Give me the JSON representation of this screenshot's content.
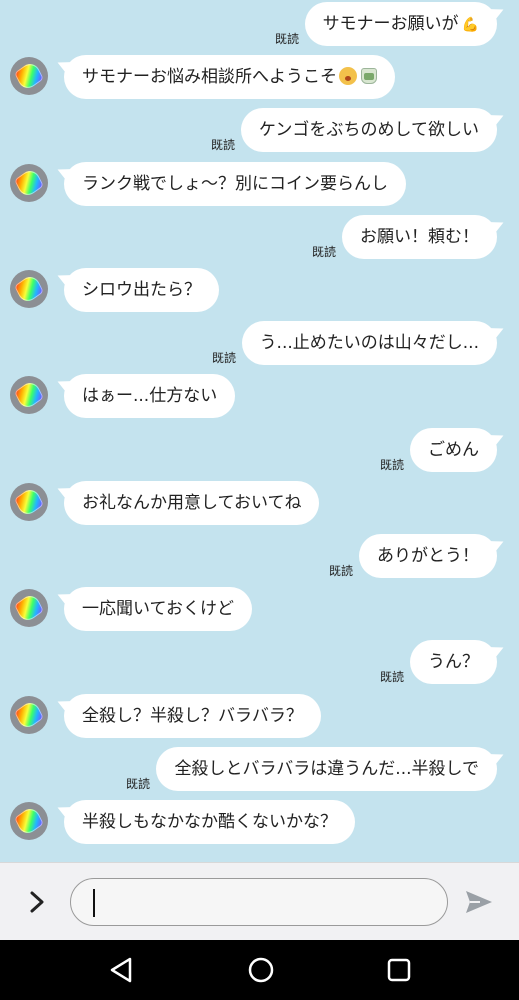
{
  "read_label": "既読",
  "messages": [
    {
      "side": "sent",
      "text": "サモナーお願いが",
      "suffix": "💪",
      "read": true
    },
    {
      "side": "recv",
      "text": "サモナーお悩み相談所へようこそ",
      "emojis": [
        "yawning-face",
        "tea-cup"
      ]
    },
    {
      "side": "sent",
      "text": "ケンゴをぶちのめして欲しい",
      "read": true
    },
    {
      "side": "recv",
      "text": "ランク戦でしょ～？別にコイン要らんし"
    },
    {
      "side": "sent",
      "text": "お願い！頼む！",
      "read": true
    },
    {
      "side": "recv",
      "text": "シロウ出たら？"
    },
    {
      "side": "sent",
      "text": "う...止めたいのは山々だし...",
      "read": true
    },
    {
      "side": "recv",
      "text": "はぁー...仕方ない"
    },
    {
      "side": "sent",
      "text": "ごめん",
      "read": true
    },
    {
      "side": "recv",
      "text": "お礼なんか用意しておいてね"
    },
    {
      "side": "sent",
      "text": "ありがとう！",
      "read": true
    },
    {
      "side": "recv",
      "text": "一応聞いておくけど"
    },
    {
      "side": "sent",
      "text": "うん？",
      "read": true
    },
    {
      "side": "recv",
      "text": "全殺し？半殺し？バラバラ？"
    },
    {
      "side": "sent",
      "text": "全殺しとバラバラは違うんだ...半殺しで",
      "read": true
    },
    {
      "side": "recv",
      "text": "半殺しもなかなか酷くないかな？"
    }
  ],
  "input": {
    "value": "",
    "expand_icon": "chevron-right-icon",
    "send_icon": "send-icon"
  },
  "nav": {
    "back_icon": "back-triangle-icon",
    "home_icon": "home-circle-icon",
    "recent_icon": "recent-square-icon"
  },
  "colors": {
    "background": "#c4e3ee",
    "bubble": "#ffffff",
    "nav": "#000000"
  }
}
